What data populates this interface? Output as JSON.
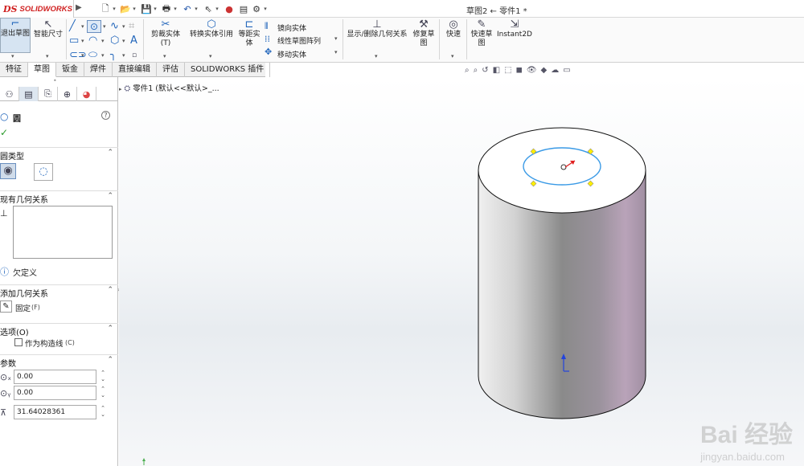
{
  "app": {
    "logo_ds": "DS",
    "logo_name": "SOLIDWORKS",
    "window_title": "草图2 ← 零件1 *"
  },
  "quick_toolbar": {
    "icons": [
      "new-document-icon",
      "open-icon",
      "save-icon",
      "print-icon",
      "undo-icon",
      "select-icon",
      "traffic-light-icon",
      "print-file-icon",
      "options-icon"
    ]
  },
  "ribbon": {
    "exit_sketch": "退出草图",
    "smart_dimension": "智能尺寸",
    "trim_entities": "剪裁实体(T)",
    "convert_entities": "转换实体引用",
    "offset_entities": "等距实体",
    "mirror_entities": "镜向实体",
    "linear_pattern": "线性草图阵列",
    "move_entities": "移动实体",
    "display_relations": "显示/删除几何关系",
    "repair_sketch": "修复草图",
    "quick_snaps": "快速",
    "rapid_sketch": "快速草图",
    "instant2d": "Instant2D"
  },
  "tabs": [
    {
      "label": "特征",
      "active": false
    },
    {
      "label": "草图",
      "active": true
    },
    {
      "label": "钣金",
      "active": false
    },
    {
      "label": "焊件",
      "active": false
    },
    {
      "label": "直接编辑",
      "active": false
    },
    {
      "label": "评估",
      "active": false
    },
    {
      "label": "SOLIDWORKS 插件",
      "active": false
    }
  ],
  "panel": {
    "feature_title": "圆",
    "help": "?",
    "circle_type_title": "圆类型",
    "existing_relations_title": "现有几何关系",
    "status": "欠定义",
    "add_relations_title": "添加几何关系",
    "fix_label": "固定",
    "fix_shortcut": "(F)",
    "options_title": "选项(O)",
    "construction_label": "作为构造线",
    "construction_shortcut": "(C)",
    "construction_checked": false,
    "params_title": "参数",
    "center_x": "0.00",
    "center_y": "0.00",
    "radius": "31.64028361"
  },
  "tree": {
    "part_name": "零件1",
    "config": "(默认<<默认>_..."
  },
  "watermark": {
    "brand": "Bai 经验",
    "url": "jingyan.baidu.com"
  }
}
